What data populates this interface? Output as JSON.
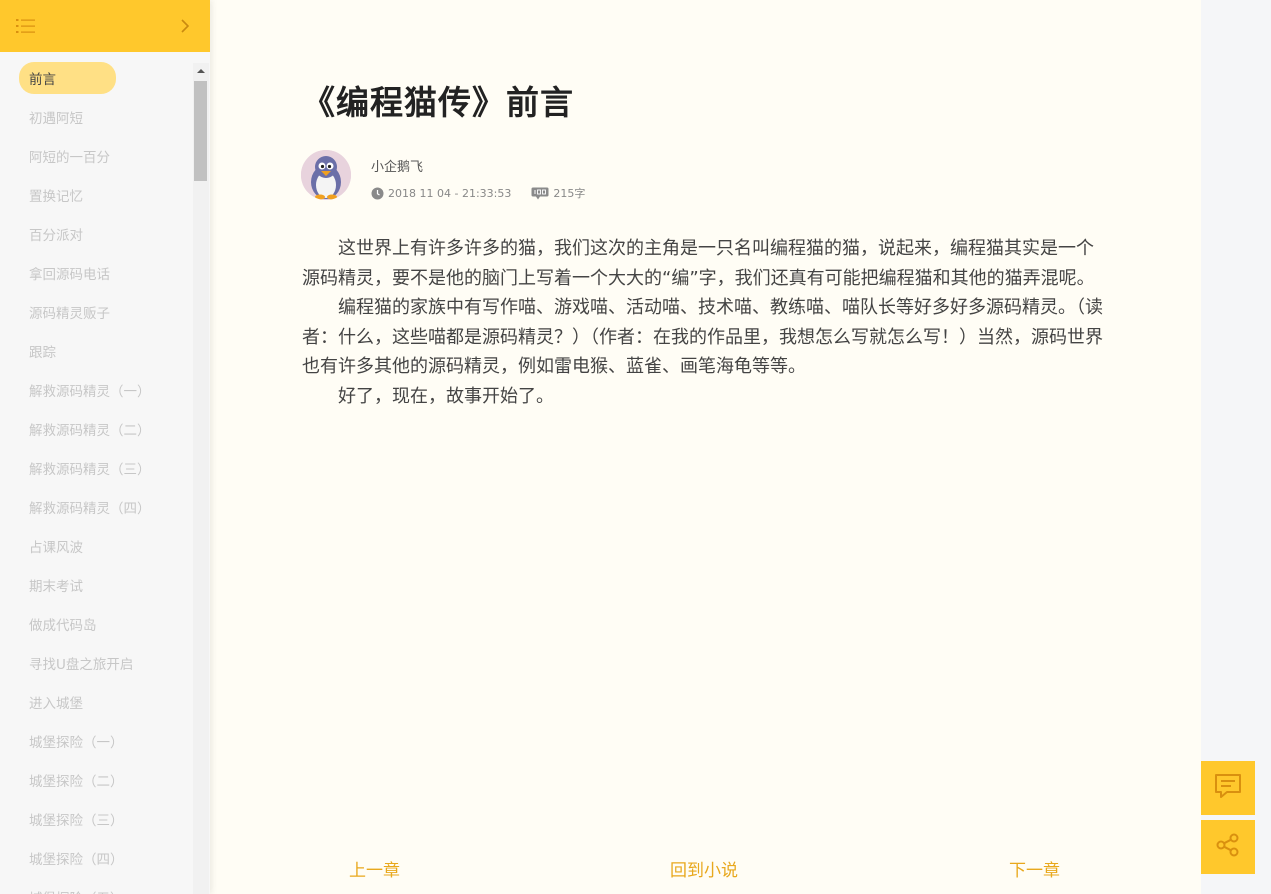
{
  "sidebar": {
    "toc": [
      {
        "label": "前言",
        "active": true
      },
      {
        "label": "初遇阿短"
      },
      {
        "label": "阿短的一百分"
      },
      {
        "label": "置换记忆"
      },
      {
        "label": "百分派对"
      },
      {
        "label": "拿回源码电话"
      },
      {
        "label": "源码精灵贩子"
      },
      {
        "label": "跟踪"
      },
      {
        "label": "解救源码精灵（一）"
      },
      {
        "label": "解救源码精灵（二）"
      },
      {
        "label": "解救源码精灵（三）"
      },
      {
        "label": "解救源码精灵（四）"
      },
      {
        "label": "占课风波"
      },
      {
        "label": "期末考试"
      },
      {
        "label": "做成代码岛"
      },
      {
        "label": "寻找U盘之旅开启"
      },
      {
        "label": "进入城堡"
      },
      {
        "label": "城堡探险（一）"
      },
      {
        "label": "城堡探险（二）"
      },
      {
        "label": "城堡探险（三）"
      },
      {
        "label": "城堡探险（四）"
      },
      {
        "label": "城堡探险（五）"
      }
    ]
  },
  "article": {
    "title": "《编程猫传》前言",
    "author": "小企鹅飞",
    "datetime": "2018 11 04 - 21:33:53",
    "word_count": "215字",
    "paragraphs": [
      "这世界上有许多许多的猫，我们这次的主角是一只名叫编程猫的猫，说起来，编程猫其实是一个源码精灵，要不是他的脑门上写着一个大大的“编”字，我们还真有可能把编程猫和其他的猫弄混呢。",
      "编程猫的家族中有写作喵、游戏喵、活动喵、技术喵、教练喵、喵队长等好多好多源码精灵。（读者：什么，这些喵都是源码精灵？）（作者：在我的作品里，我想怎么写就怎么写！）当然，源码世界也有许多其他的源码精灵，例如雷电猴、蓝雀、画笔海龟等等。",
      "好了，现在，故事开始了。"
    ]
  },
  "nav": {
    "prev": "上一章",
    "back": "回到小说",
    "next": "下一章"
  },
  "colors": {
    "accent": "#ffc82c",
    "link": "#e8a81d",
    "active_item": "#ffe085",
    "page_bg": "#fffdf5"
  },
  "icons": {
    "menu": "list-menu-icon",
    "collapse": "chevron-right-icon",
    "clock": "clock-icon",
    "words": "word-count-icon",
    "comment": "comment-icon",
    "share": "share-icon"
  }
}
